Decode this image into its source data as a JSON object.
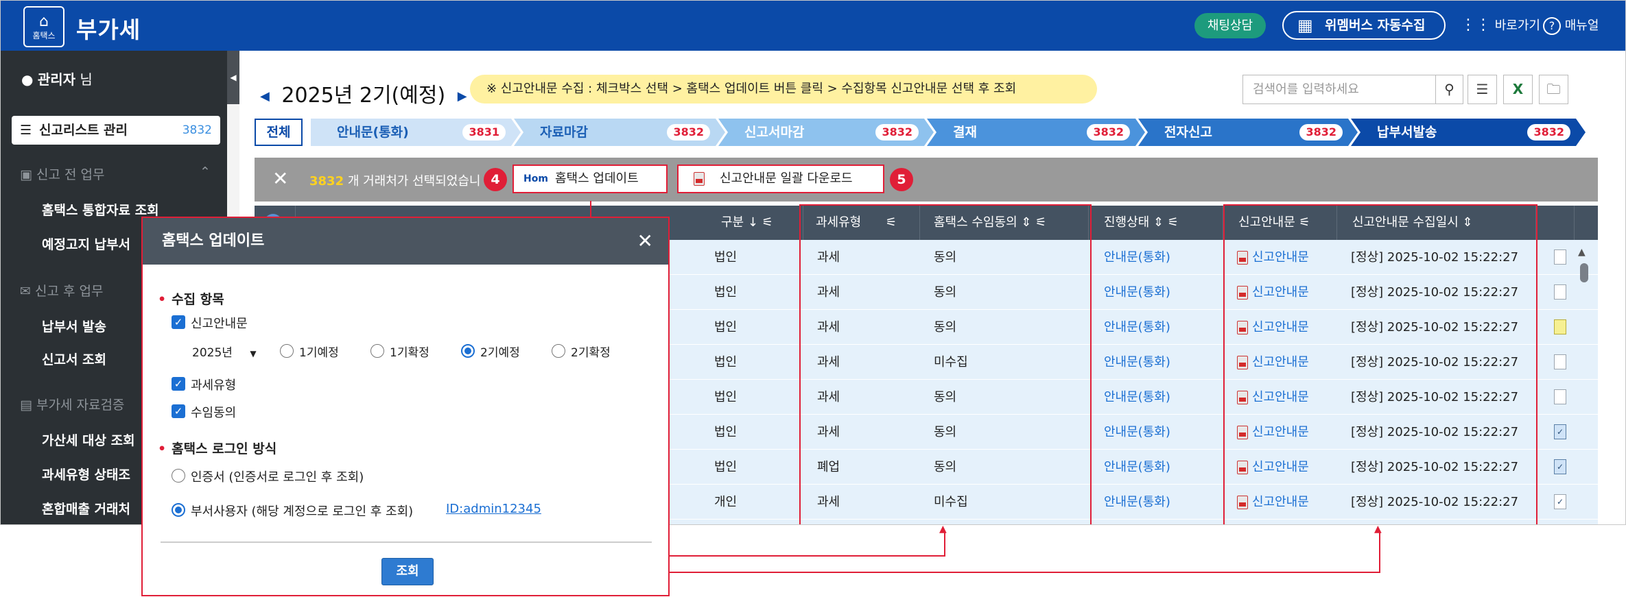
{
  "app": {
    "logo_text_top": "Hom tax",
    "logo_text_bottom": "홈택스",
    "title": "부가세"
  },
  "header": {
    "chat_label": "채팅상담",
    "collect_label": "위멤버스 자동수집",
    "shortcut_label": "바로가기",
    "manual_label": "매뉴얼"
  },
  "sidebar": {
    "user_name": "관리자",
    "user_suffix": "님",
    "active_item": {
      "label": "신고리스트 관리",
      "count": "3832"
    },
    "sections": [
      {
        "title": "신고 전 업무",
        "items": [
          "홈택스 통합자료 조회",
          "예정고지 납부서"
        ]
      },
      {
        "title": "신고 후 업무",
        "items": [
          "납부서 발송",
          "신고서 조회"
        ]
      },
      {
        "title": "부가세 자료검증",
        "items": [
          "가산세 대상 조회",
          "과세유형 상태조",
          "혼합매출 거래처"
        ]
      }
    ]
  },
  "period": {
    "label": "2025년 2기(예정)"
  },
  "notice": "※ 신고안내문 수집 : 체크박스 선택 > 홈택스 업데이트 버튼 클릭 > 수집항목 신고안내문 선택 후 조회",
  "search": {
    "placeholder": "검색어를 입력하세요"
  },
  "steps": {
    "all_label": "전체",
    "items": [
      {
        "label": "안내문(통화)",
        "count": "3831",
        "color": "#cfe3f7",
        "text_color": "#1b5fb5"
      },
      {
        "label": "자료마감",
        "count": "3832",
        "color": "#b9d8f3",
        "text_color": "#1b5fb5"
      },
      {
        "label": "신고서마감",
        "count": "3832",
        "color": "#8ec2ee",
        "text_color": "#ffffff"
      },
      {
        "label": "결재",
        "count": "3832",
        "color": "#4b93dc",
        "text_color": "#ffffff"
      },
      {
        "label": "전자신고",
        "count": "3832",
        "color": "#2a74c9",
        "text_color": "#ffffff"
      },
      {
        "label": "납부서발송",
        "count": "3832",
        "color": "#0b4aa8",
        "text_color": "#ffffff"
      }
    ]
  },
  "selection": {
    "count": "3832",
    "text": "개 거래처가 선택되었습니",
    "update_button": "홈택스 업데이트",
    "update_badge": "4",
    "download_button": "신고안내문 일괄 다운로드",
    "download_badge": "5"
  },
  "table": {
    "headers": {
      "type": "구분",
      "tax_type": "과세유형",
      "consent": "홈택스 수임동의",
      "status": "진행상태",
      "notice_doc": "신고안내문",
      "collected_at": "신고안내문 수집일시"
    },
    "rows": [
      {
        "type": "법인",
        "tax_type": "과세",
        "consent": "동의",
        "status": "안내문(통화)",
        "notice_doc": "신고안내문",
        "collected_at": "[정상] 2025-10-02 15:22:27",
        "doc": "plain"
      },
      {
        "type": "법인",
        "tax_type": "과세",
        "consent": "동의",
        "status": "안내문(통화)",
        "notice_doc": "신고안내문",
        "collected_at": "[정상] 2025-10-02 15:22:27",
        "doc": "plain"
      },
      {
        "type": "법인",
        "tax_type": "과세",
        "consent": "동의",
        "status": "안내문(통화)",
        "notice_doc": "신고안내문",
        "collected_at": "[정상] 2025-10-02 15:22:27",
        "doc": "yellow"
      },
      {
        "type": "법인",
        "tax_type": "과세",
        "consent": "미수집",
        "status": "안내문(통화)",
        "notice_doc": "신고안내문",
        "collected_at": "[정상] 2025-10-02 15:22:27",
        "doc": "plain"
      },
      {
        "type": "법인",
        "tax_type": "과세",
        "consent": "동의",
        "status": "안내문(통화)",
        "notice_doc": "신고안내문",
        "collected_at": "[정상] 2025-10-02 15:22:27",
        "doc": "plain"
      },
      {
        "type": "법인",
        "tax_type": "과세",
        "consent": "동의",
        "status": "안내문(통화)",
        "notice_doc": "신고안내문",
        "collected_at": "[정상] 2025-10-02 15:22:27",
        "doc": "blue"
      },
      {
        "type": "법인",
        "tax_type": "폐업",
        "consent": "동의",
        "status": "안내문(통화)",
        "notice_doc": "신고안내문",
        "collected_at": "[정상] 2025-10-02 15:22:27",
        "doc": "blue"
      },
      {
        "type": "개인",
        "tax_type": "과세",
        "consent": "미수집",
        "status": "안내문(통화)",
        "notice_doc": "신고안내문",
        "collected_at": "[정상] 2025-10-02 15:22:27",
        "doc": "check"
      }
    ]
  },
  "modal": {
    "title": "홈택스 업데이트",
    "section_collect": "수집 항목",
    "item_notice": "신고안내문",
    "year_select": "2025년",
    "periods": [
      "1기예정",
      "1기확정",
      "2기예정",
      "2기확정"
    ],
    "selected_period": "2기예정",
    "item_tax_type": "과세유형",
    "item_consent": "수임동의",
    "section_login": "홈택스 로그인 방식",
    "login_cert": "인증서 (인증서로 로그인 후 조회)",
    "login_sub": "부서사용자 (해당 계정으로 로그인 후 조회)",
    "login_id": "ID:admin12345",
    "submit": "조회"
  },
  "colors": {
    "brand": "#0b4aa8",
    "highlight": "#e01e37",
    "notice_bg": "#fff1a1"
  }
}
